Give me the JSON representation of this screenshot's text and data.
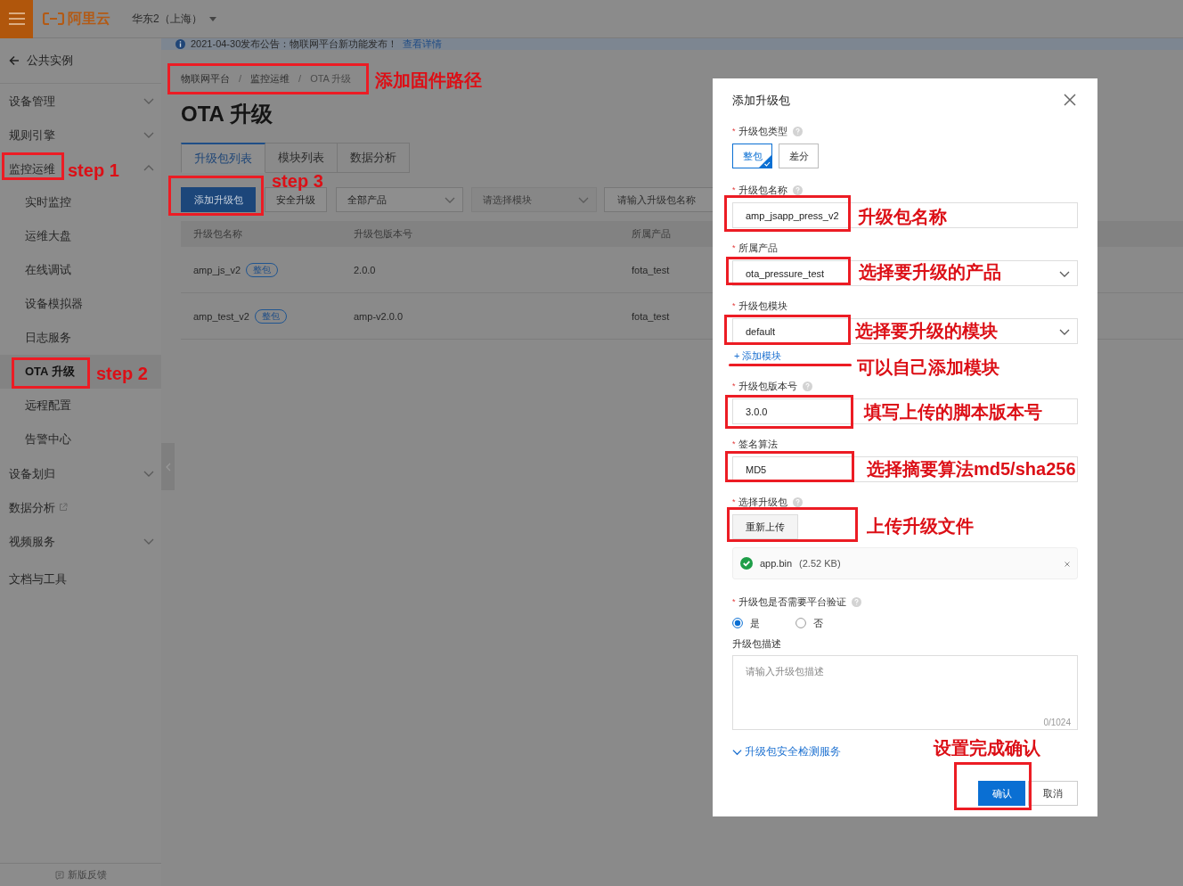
{
  "topbar": {
    "logo": "阿里云",
    "region": "华东2（上海）"
  },
  "notice": {
    "text": "2021-04-30发布公告：物联网平台新功能发布！",
    "link": "查看详情"
  },
  "sidebar": {
    "back": "公共实例",
    "items": [
      {
        "label": "设备管理",
        "kind": "group",
        "expanded": false
      },
      {
        "label": "规则引擎",
        "kind": "group",
        "expanded": false
      },
      {
        "label": "监控运维",
        "kind": "group",
        "expanded": true,
        "children": [
          {
            "label": "实时监控",
            "selected": false
          },
          {
            "label": "运维大盘",
            "selected": false
          },
          {
            "label": "在线调试",
            "selected": false
          },
          {
            "label": "设备模拟器",
            "selected": false
          },
          {
            "label": "日志服务",
            "selected": false
          },
          {
            "label": "OTA 升级",
            "selected": true
          },
          {
            "label": "远程配置",
            "selected": false
          },
          {
            "label": "告警中心",
            "selected": false
          }
        ]
      },
      {
        "label": "设备划归",
        "kind": "group",
        "expanded": false
      },
      {
        "label": "数据分析",
        "kind": "external"
      },
      {
        "label": "视频服务",
        "kind": "group",
        "expanded": false
      },
      {
        "label": "文档与工具",
        "kind": "link"
      }
    ],
    "feedback": "新版反馈"
  },
  "breadcrumb": [
    {
      "kind": "item",
      "text": "物联网平台"
    },
    {
      "kind": "separator",
      "text": "/"
    },
    {
      "kind": "item",
      "text": "监控运维"
    },
    {
      "kind": "separator",
      "text": "/"
    },
    {
      "kind": "current",
      "text": "OTA 升级"
    }
  ],
  "title": "OTA 升级",
  "tabs": [
    {
      "label": "升级包列表",
      "selected": true
    },
    {
      "label": "模块列表",
      "selected": false
    },
    {
      "label": "数据分析",
      "selected": false
    }
  ],
  "toolbar": {
    "primary": "添加升级包",
    "secondary": "安全升级",
    "product_select": "全部产品",
    "module_select": {
      "placeholder": "请选择模块",
      "disabled": true
    },
    "search": {
      "placeholder": "请输入升级包名称"
    }
  },
  "table": {
    "columns": [
      "升级包名称",
      "升级包版本号",
      "所属产品"
    ],
    "rows": [
      {
        "name": "amp_js_v2",
        "tag": "整包",
        "version": "2.0.0",
        "product": "fota_test"
      },
      {
        "name": "amp_test_v2",
        "tag": "整包",
        "version": "amp-v2.0.0",
        "product": "fota_test"
      }
    ]
  },
  "dialog": {
    "title": "添加升级包",
    "type_label": {
      "mark": "*",
      "text": "升级包类型"
    },
    "type_options": [
      {
        "label": "整包",
        "selected": true
      },
      {
        "label": "差分",
        "selected": false
      }
    ],
    "name_label": {
      "mark": "*",
      "text": "升级包名称"
    },
    "name_value": "amp_jsapp_press_v2",
    "product_label": {
      "mark": "*",
      "text": "所属产品"
    },
    "product_value": "ota_pressure_test",
    "module_label": {
      "mark": "*",
      "text": "升级包模块"
    },
    "module_value": "default",
    "add_module": "+ 添加模块",
    "version_label": {
      "mark": "*",
      "text": "升级包版本号"
    },
    "version_value": "3.0.0",
    "sign_label": {
      "mark": "*",
      "text": "签名算法"
    },
    "sign_value": "MD5",
    "file_label": {
      "mark": "*",
      "text": "选择升级包"
    },
    "upload_button": "重新上传",
    "file_name": "app.bin",
    "file_size": "(2.52 KB)",
    "verify_label": {
      "mark": "*",
      "text": "升级包是否需要平台验证"
    },
    "verify_options": [
      {
        "label": "是",
        "selected": true
      },
      {
        "label": "否",
        "selected": false
      }
    ],
    "desc_label": "升级包描述",
    "desc_placeholder": "请输入升级包描述",
    "desc_counter": "0/1024",
    "security_link": "升级包安全检测服务",
    "confirm": "确认",
    "cancel": "取消"
  },
  "annotations": [
    {
      "kind": "box"
    },
    {
      "kind": "label",
      "text": "添加固件路径"
    },
    {
      "kind": "box"
    },
    {
      "kind": "label",
      "text": "step 1"
    },
    {
      "kind": "box"
    },
    {
      "kind": "label",
      "text": "step 2"
    },
    {
      "kind": "box"
    },
    {
      "kind": "label",
      "text": "step 3"
    },
    {
      "kind": "box"
    },
    {
      "kind": "label",
      "text": "升级包名称"
    },
    {
      "kind": "box"
    },
    {
      "kind": "label",
      "text": "选择要升级的产品"
    },
    {
      "kind": "box"
    },
    {
      "kind": "label",
      "text": "选择要升级的模块"
    },
    {
      "kind": "underline"
    },
    {
      "kind": "label",
      "text": "可以自己添加模块"
    },
    {
      "kind": "box"
    },
    {
      "kind": "label",
      "text": "填写上传的脚本版本号"
    },
    {
      "kind": "box"
    },
    {
      "kind": "label",
      "text": "选择摘要算法md5/sha256"
    },
    {
      "kind": "box"
    },
    {
      "kind": "label",
      "text": "上传升级文件"
    },
    {
      "kind": "label",
      "text": "设置完成确认"
    },
    {
      "kind": "box"
    }
  ]
}
